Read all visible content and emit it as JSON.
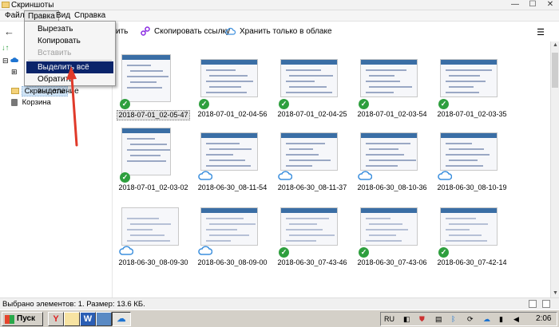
{
  "window": {
    "title": "Скриншоты",
    "controls": [
      "—",
      "☐",
      "✕"
    ]
  },
  "menubar": {
    "items": [
      "Файл",
      "Правка",
      "Вид",
      "Справка"
    ]
  },
  "edit_menu": {
    "items": [
      {
        "label": "Вырезать",
        "state": "normal"
      },
      {
        "label": "Копировать",
        "state": "normal"
      },
      {
        "label": "Вставить",
        "state": "disabled"
      },
      {
        "label": "Выделить всё",
        "state": "highlighted"
      },
      {
        "label": "Обратить выделение",
        "state": "normal"
      }
    ]
  },
  "toolbar": {
    "back_icon": "arrow-left-icon",
    "partial_label": "ить",
    "copy_link_label": "Скопировать ссылку",
    "cloud_only_label": "Хранить только в облаке",
    "view_icon": "list-view-icon"
  },
  "sidebar": {
    "items": [
      {
        "label": "Скриншоты",
        "icon": "folder-icon",
        "selected": true
      },
      {
        "label": "Корзина",
        "icon": "trash-icon",
        "selected": false
      }
    ]
  },
  "files": [
    {
      "name": "2018-07-01_02-05-47",
      "status": "synced",
      "selected": true
    },
    {
      "name": "2018-07-01_02-04-56",
      "status": "synced",
      "selected": false
    },
    {
      "name": "2018-07-01_02-04-25",
      "status": "synced",
      "selected": false
    },
    {
      "name": "2018-07-01_02-03-54",
      "status": "synced",
      "selected": false
    },
    {
      "name": "2018-07-01_02-03-35",
      "status": "synced",
      "selected": false
    },
    {
      "name": "2018-07-01_02-03-02",
      "status": "synced",
      "selected": false
    },
    {
      "name": "2018-06-30_08-11-54",
      "status": "cloud",
      "selected": false
    },
    {
      "name": "2018-06-30_08-11-37",
      "status": "cloud",
      "selected": false
    },
    {
      "name": "2018-06-30_08-10-36",
      "status": "cloud",
      "selected": false
    },
    {
      "name": "2018-06-30_08-10-19",
      "status": "cloud",
      "selected": false
    },
    {
      "name": "2018-06-30_08-09-30",
      "status": "cloud",
      "selected": false
    },
    {
      "name": "2018-06-30_08-09-00",
      "status": "cloud",
      "selected": false
    },
    {
      "name": "2018-06-30_07-43-46",
      "status": "synced",
      "selected": false
    },
    {
      "name": "2018-06-30_07-43-06",
      "status": "synced",
      "selected": false
    },
    {
      "name": "2018-06-30_07-42-14",
      "status": "synced",
      "selected": false
    }
  ],
  "statusbar": {
    "text": "Выбрано элементов: 1. Размер: 13.6 КБ."
  },
  "taskbar": {
    "start_label": "Пуск",
    "lang": "RU",
    "clock": "2:06"
  },
  "colors": {
    "synced": "#2e9f3e",
    "cloud": "#3c8fdd",
    "highlight": "#0a246a"
  }
}
